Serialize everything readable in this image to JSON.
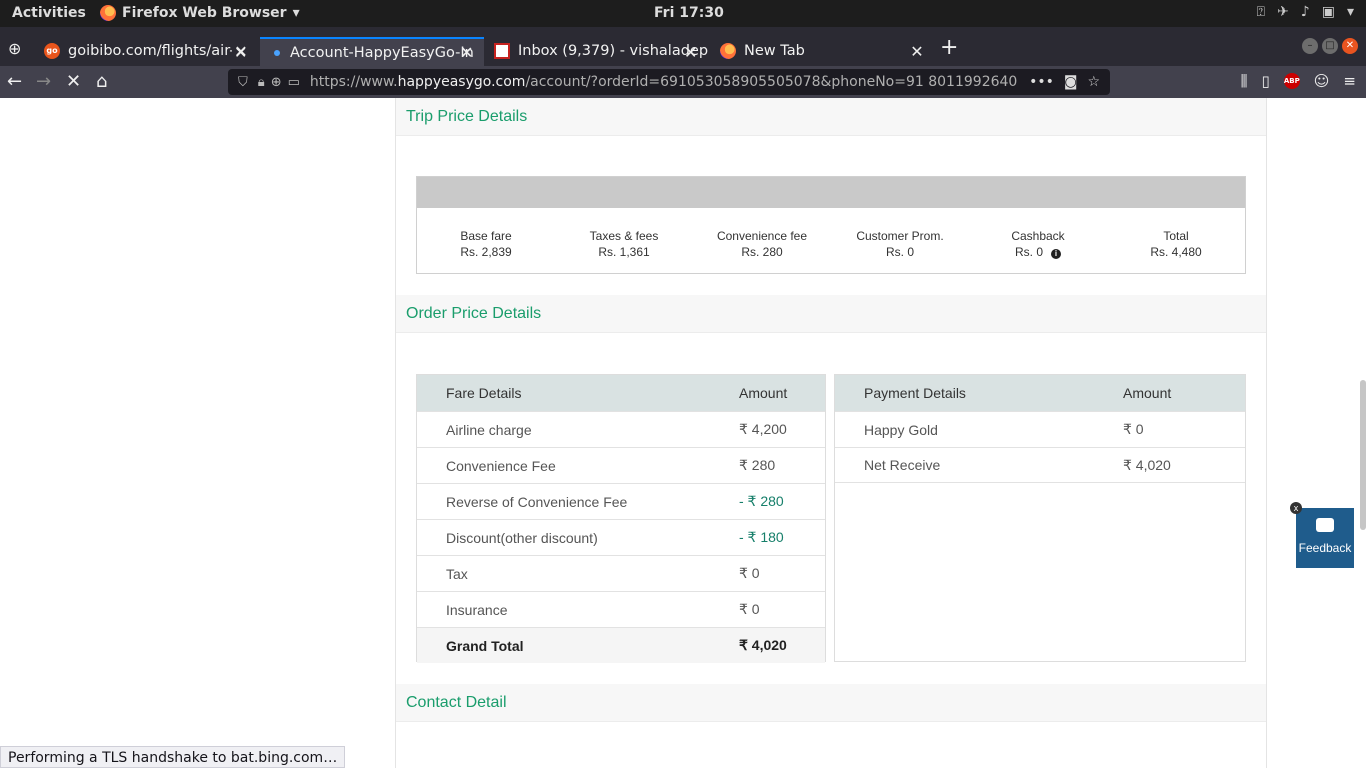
{
  "system_bar": {
    "activities": "Activities",
    "app_name": "Firefox Web Browser",
    "clock": "Fri 17:30"
  },
  "tabs": [
    {
      "title": "goibibo.com/flights/air-C",
      "close": "✕"
    },
    {
      "title": "Account-HappyEasyGo-In",
      "close": "✕"
    },
    {
      "title": "Inbox (9,379) - vishaladep",
      "close": "✕"
    },
    {
      "title": "New Tab",
      "close": "✕"
    }
  ],
  "url": {
    "prefix": "https://www.",
    "domain": "happyeasygo.com",
    "path": "/account/?orderId=691053058905505078&phoneNo=91 8011992640"
  },
  "sections": {
    "trip": "Trip Price Details",
    "order": "Order Price Details",
    "contact": "Contact Detail"
  },
  "trip_price": [
    {
      "label": "Base fare",
      "value": "Rs. 2,839"
    },
    {
      "label": "Taxes & fees",
      "value": "Rs. 1,361"
    },
    {
      "label": "Convenience fee",
      "value": "Rs. 280"
    },
    {
      "label": "Customer Prom.",
      "value": "Rs. 0"
    },
    {
      "label": "Cashback",
      "value": "Rs. 0"
    },
    {
      "label": "Total",
      "value": "Rs. 4,480"
    }
  ],
  "fare_table": {
    "headers": [
      "Fare Details",
      "Amount"
    ],
    "rows": [
      {
        "label": "Airline charge",
        "amount": "₹ 4,200"
      },
      {
        "label": "Convenience Fee",
        "amount": "₹ 280"
      },
      {
        "label": "Reverse of Convenience Fee",
        "amount": "- ₹ 280"
      },
      {
        "label": "Discount(other discount)",
        "amount": "- ₹ 180"
      },
      {
        "label": "Tax",
        "amount": "₹ 0"
      },
      {
        "label": "Insurance",
        "amount": "₹ 0"
      }
    ],
    "total": {
      "label": "Grand Total",
      "amount": "₹ 4,020"
    }
  },
  "payment_table": {
    "headers": [
      "Payment Details",
      "Amount"
    ],
    "rows": [
      {
        "label": "Happy Gold",
        "amount": "₹ 0"
      },
      {
        "label": "Net Receive",
        "amount": "₹ 4,020"
      }
    ]
  },
  "feedback": {
    "label": "Feedback",
    "close": "x"
  },
  "status_text": "Performing a TLS handshake to bat.bing.com…",
  "colors": {
    "accent": "#1a9d6c",
    "table_header": "#d9e2e2",
    "feedback_bg": "#1f5c8c"
  }
}
